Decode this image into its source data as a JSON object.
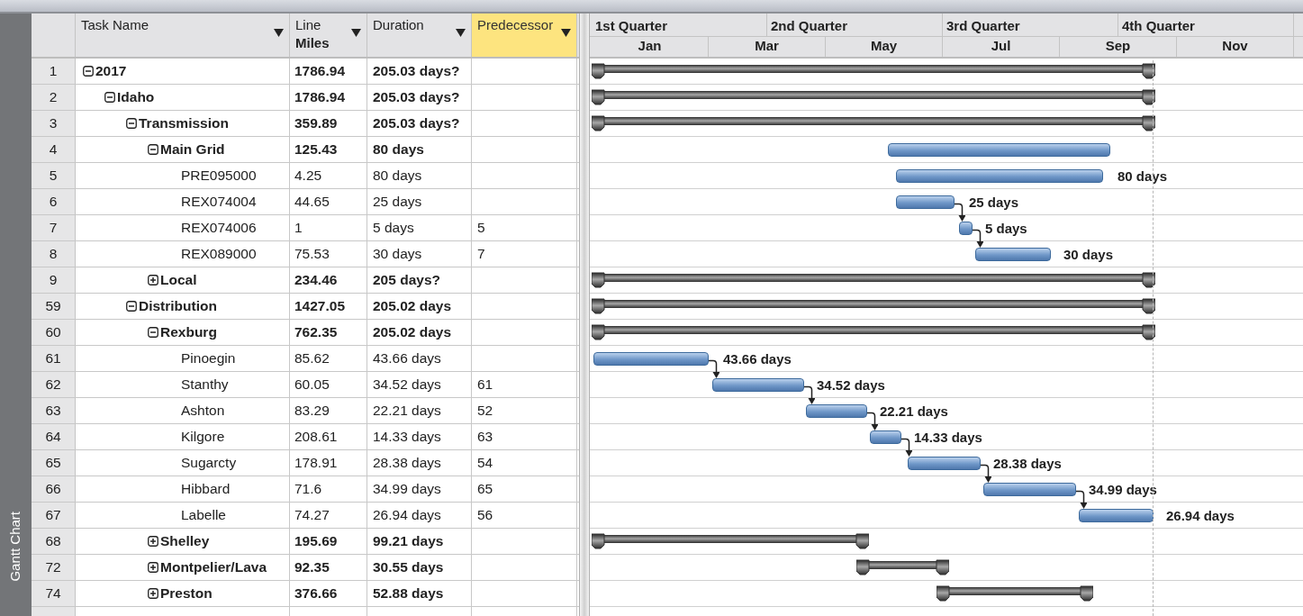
{
  "side_tab": {
    "label": "Gantt Chart"
  },
  "columns": [
    {
      "label": "Task Name",
      "selected": false
    },
    {
      "label": "Line",
      "sublabel": "Miles",
      "selected": false
    },
    {
      "label": "Duration",
      "selected": false
    },
    {
      "label": "Predecessor",
      "selected": true
    }
  ],
  "timescale": {
    "quarters": [
      "1st Quarter",
      "2nd Quarter",
      "3rd Quarter",
      "4th Quarter"
    ],
    "months": [
      "Jan",
      "Mar",
      "May",
      "Jul",
      "Sep",
      "Nov"
    ]
  },
  "tasks": [
    {
      "id": "1",
      "name": "2017",
      "kind": "summary",
      "expanded": true,
      "miles": "1786.94",
      "duration": "205.03 days?",
      "children": [
        {
          "id": "2",
          "name": "Idaho",
          "kind": "summary",
          "expanded": true,
          "miles": "1786.94",
          "duration": "205.03 days?",
          "children": [
            {
              "id": "3",
              "name": "Transmission",
              "kind": "summary",
              "expanded": true,
              "miles": "359.89",
              "duration": "205.03 days?",
              "children": [
                {
                  "id": "4",
                  "name": "Main Grid",
                  "kind": "summary",
                  "expanded": true,
                  "miles": "125.43",
                  "duration": "80 days",
                  "children": [
                    {
                      "id": "5",
                      "name": "PRE095000",
                      "kind": "task",
                      "miles": "4.25",
                      "duration": "80 days",
                      "bar_label": "80 days",
                      "linked": false
                    },
                    {
                      "id": "6",
                      "name": "REX074004",
                      "kind": "task",
                      "miles": "44.65",
                      "duration": "25 days",
                      "bar_label": "25 days",
                      "linked": false
                    },
                    {
                      "id": "7",
                      "name": "REX074006",
                      "kind": "task",
                      "miles": "1",
                      "duration": "5 days",
                      "predecessor": "5",
                      "bar_label": "5 days",
                      "linked": true
                    },
                    {
                      "id": "8",
                      "name": "REX089000",
                      "kind": "task",
                      "miles": "75.53",
                      "duration": "30 days",
                      "predecessor": "7",
                      "bar_label": "30 days",
                      "linked": true
                    }
                  ]
                },
                {
                  "id": "9",
                  "name": "Local",
                  "kind": "summary",
                  "expanded": false,
                  "miles": "234.46",
                  "duration": "205 days?"
                }
              ]
            },
            {
              "id": "59",
              "name": "Distribution",
              "kind": "summary",
              "expanded": true,
              "miles": "1427.05",
              "duration": "205.02 days",
              "children": [
                {
                  "id": "60",
                  "name": "Rexburg",
                  "kind": "summary",
                  "expanded": true,
                  "miles": "762.35",
                  "duration": "205.02 days",
                  "children": [
                    {
                      "id": "61",
                      "name": "Pinoegin",
                      "kind": "task",
                      "miles": "85.62",
                      "duration": "43.66 days",
                      "bar_label": "43.66 days",
                      "linked": false
                    },
                    {
                      "id": "62",
                      "name": "Stanthy",
                      "kind": "task",
                      "miles": "60.05",
                      "duration": "34.52 days",
                      "predecessor": "61",
                      "bar_label": "34.52 days",
                      "linked": true
                    },
                    {
                      "id": "63",
                      "name": "Ashton",
                      "kind": "task",
                      "miles": "83.29",
                      "duration": "22.21 days",
                      "predecessor": "52",
                      "bar_label": "22.21 days",
                      "linked": true
                    },
                    {
                      "id": "64",
                      "name": "Kilgore",
                      "kind": "task",
                      "miles": "208.61",
                      "duration": "14.33 days",
                      "predecessor": "63",
                      "bar_label": "14.33 days",
                      "linked": true
                    },
                    {
                      "id": "65",
                      "name": "Sugarcty",
                      "kind": "task",
                      "miles": "178.91",
                      "duration": "28.38 days",
                      "predecessor": "54",
                      "bar_label": "28.38 days",
                      "linked": true
                    },
                    {
                      "id": "66",
                      "name": "Hibbard",
                      "kind": "task",
                      "miles": "71.6",
                      "duration": "34.99 days",
                      "predecessor": "65",
                      "bar_label": "34.99 days",
                      "linked": true
                    },
                    {
                      "id": "67",
                      "name": "Labelle",
                      "kind": "task",
                      "miles": "74.27",
                      "duration": "26.94 days",
                      "predecessor": "56",
                      "bar_label": "26.94 days",
                      "linked": true
                    }
                  ]
                },
                {
                  "id": "68",
                  "name": "Shelley",
                  "kind": "summary",
                  "expanded": false,
                  "miles": "195.69",
                  "duration": "99.21 days"
                },
                {
                  "id": "72",
                  "name": "Montpelier/Lava",
                  "kind": "summary",
                  "expanded": false,
                  "miles": "92.35",
                  "duration": "30.55 days"
                },
                {
                  "id": "74",
                  "name": "Preston",
                  "kind": "summary",
                  "expanded": false,
                  "miles": "376.66",
                  "duration": "52.88 days"
                }
              ]
            }
          ]
        }
      ]
    }
  ]
}
